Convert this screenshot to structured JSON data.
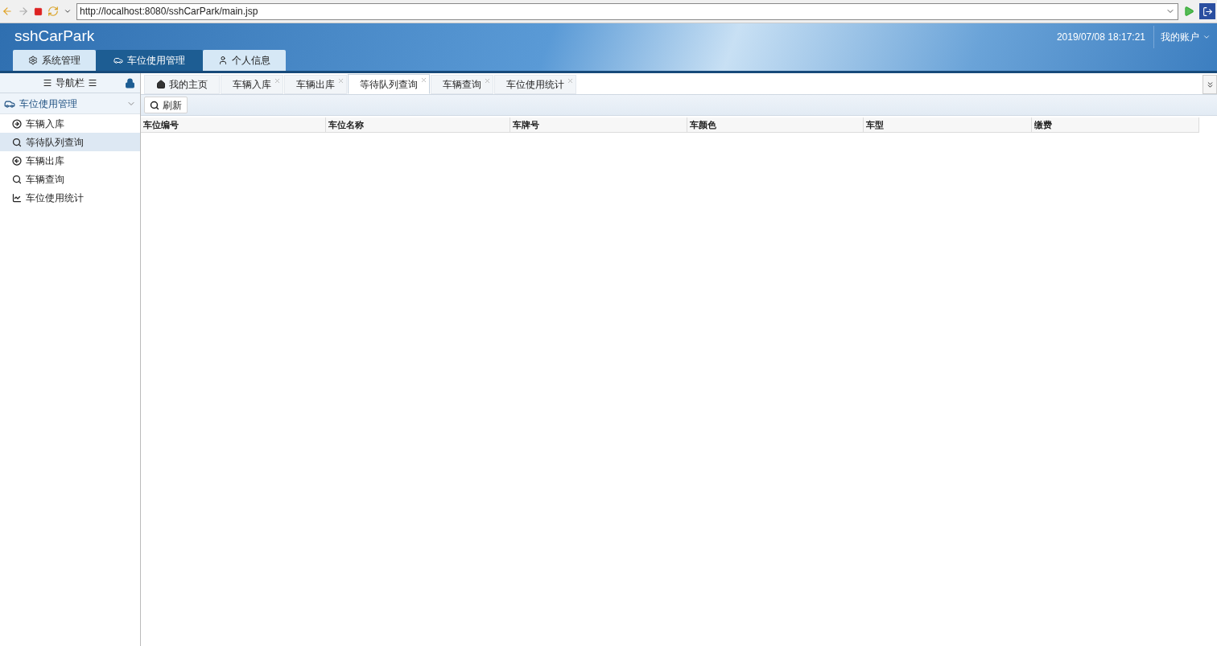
{
  "browser": {
    "url": "http://localhost:8080/sshCarPark/main.jsp"
  },
  "header": {
    "title": "sshCarPark",
    "datetime": "2019/07/08 18:17:21",
    "account": "我的账户"
  },
  "nav_tabs": [
    {
      "label": "系统管理",
      "selected": false
    },
    {
      "label": "车位使用管理",
      "selected": true
    },
    {
      "label": "个人信息",
      "selected": false
    }
  ],
  "sidebar": {
    "title": "导航栏",
    "group": {
      "label": "车位使用管理",
      "expanded": true
    },
    "items": [
      {
        "label": "车辆入库",
        "selected": false
      },
      {
        "label": "等待队列查询",
        "selected": true
      },
      {
        "label": "车辆出库",
        "selected": false
      },
      {
        "label": "车辆查询",
        "selected": false
      },
      {
        "label": "车位使用统计",
        "selected": false
      }
    ]
  },
  "tabs": [
    {
      "label": "我的主页",
      "selected": false,
      "closable": false
    },
    {
      "label": "车辆入库",
      "selected": false,
      "closable": true
    },
    {
      "label": "车辆出库",
      "selected": false,
      "closable": true
    },
    {
      "label": "等待队列查询",
      "selected": true,
      "closable": true
    },
    {
      "label": "车辆查询",
      "selected": false,
      "closable": true
    },
    {
      "label": "车位使用统计",
      "selected": false,
      "closable": true
    }
  ],
  "toolbar": {
    "buttons": [
      {
        "label": "刷新"
      }
    ]
  },
  "table": {
    "columns": [
      "车位编号",
      "车位名称",
      "车牌号",
      "车颜色",
      "车型",
      "缴费"
    ]
  }
}
